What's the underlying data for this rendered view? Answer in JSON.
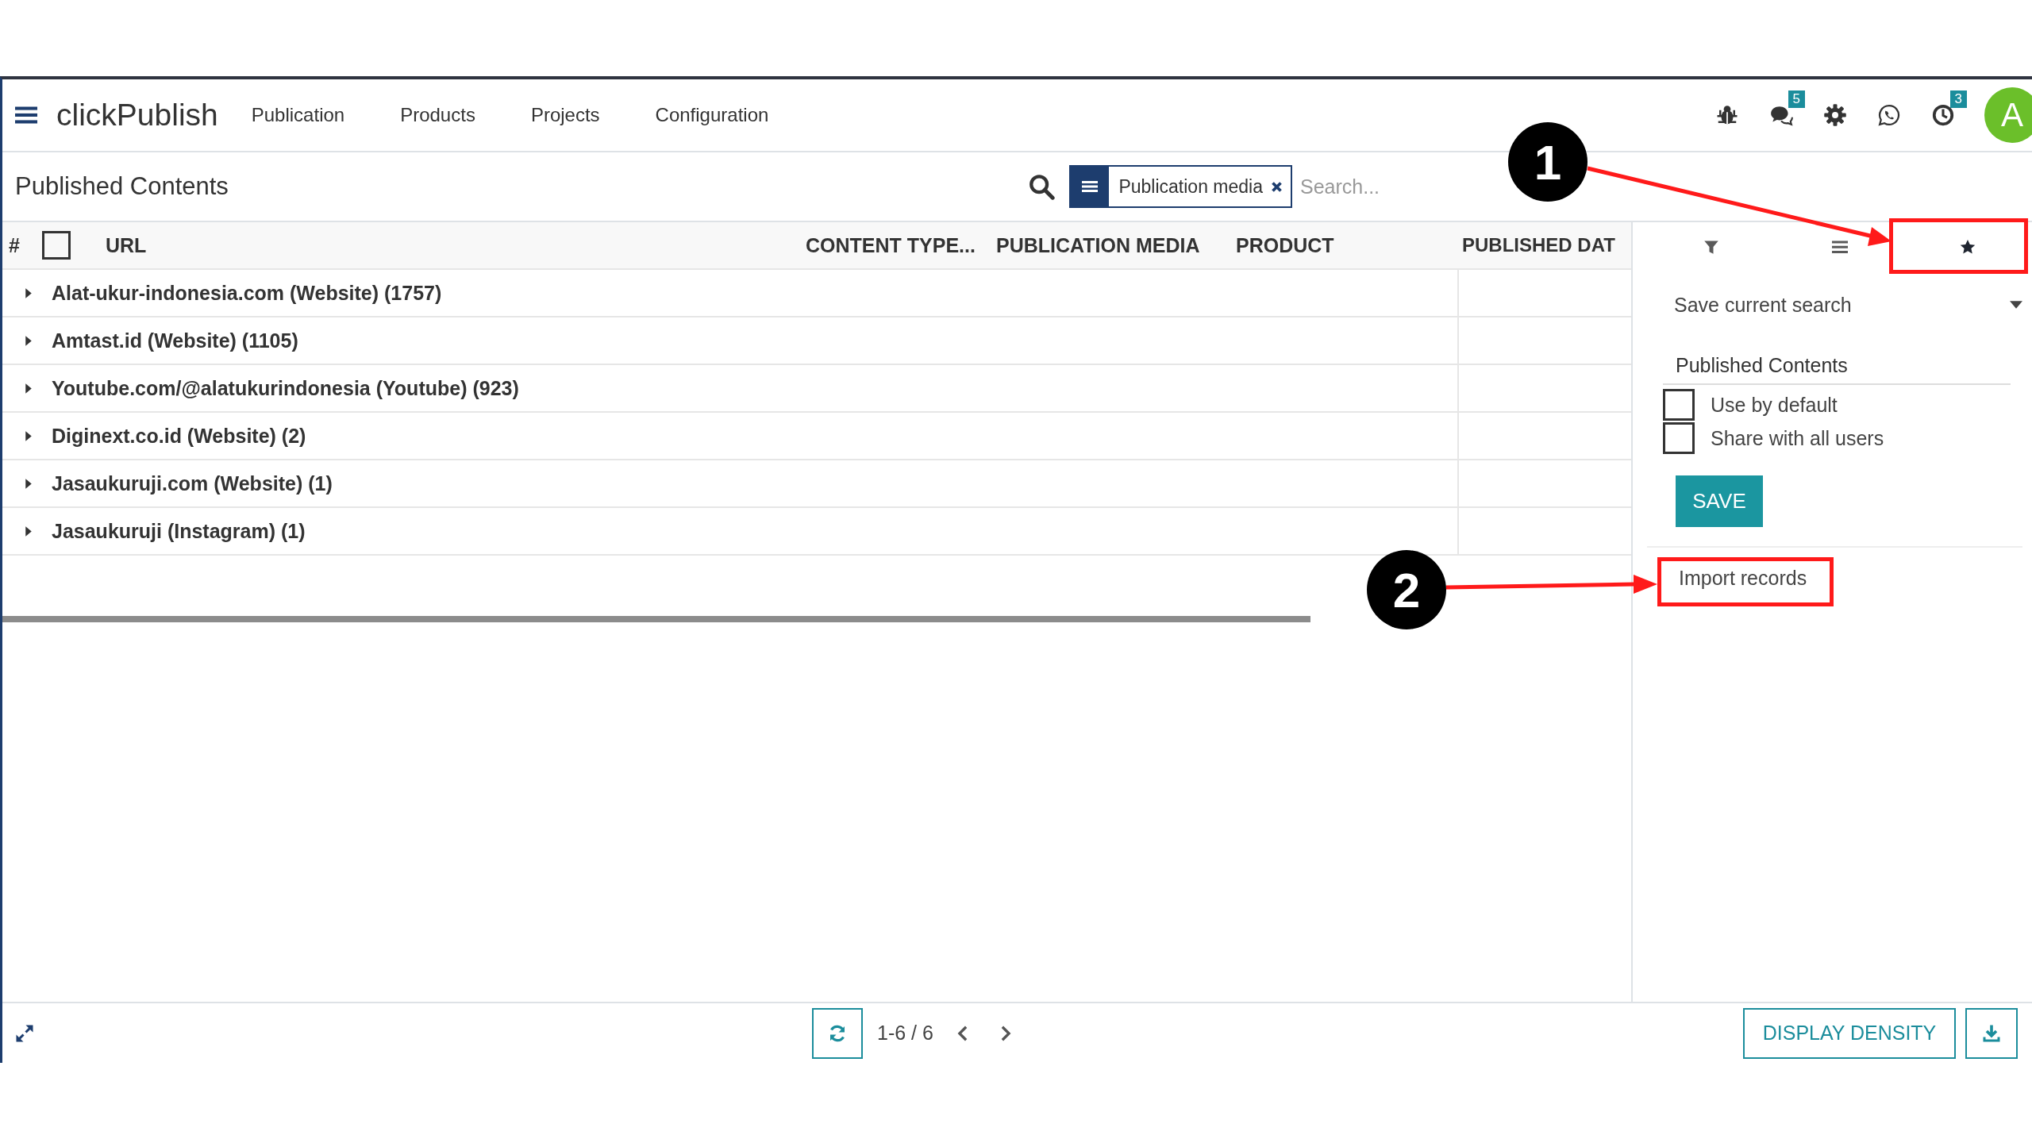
{
  "navbar": {
    "brand": "clickPublish",
    "menu": [
      "Publication",
      "Products",
      "Projects",
      "Configuration"
    ],
    "messages_badge": "5",
    "activities_badge": "3",
    "avatar": "A"
  },
  "control_panel": {
    "title": "Published Contents",
    "facet": "Publication media",
    "search_placeholder": "Search..."
  },
  "table": {
    "columns": [
      "#",
      "URL",
      "CONTENT TYPE...",
      "PUBLICATION MEDIA",
      "PRODUCT",
      "PUBLISHED DAT"
    ],
    "select_all_checked": false,
    "groups": [
      {
        "label": "Alat-ukur-indonesia.com (Website) (1757)",
        "expanded": false
      },
      {
        "label": "Amtast.id (Website) (1105)",
        "expanded": false
      },
      {
        "label": "Youtube.com/@alatukurindonesia (Youtube) (923)",
        "expanded": false
      },
      {
        "label": "Diginext.co.id (Website) (2)",
        "expanded": false
      },
      {
        "label": "Jasaukuruji.com (Website) (1)",
        "expanded": false
      },
      {
        "label": "Jasaukuruji (Instagram) (1)",
        "expanded": false
      }
    ]
  },
  "search_panel": {
    "tabs": [
      {
        "selected": false
      },
      {
        "selected": false
      },
      {
        "selected": true
      }
    ],
    "save_search": {
      "label": "Save current search",
      "expanded": true,
      "name": "Published Contents",
      "options": [
        {
          "label": "Use by default",
          "checked": false
        },
        {
          "label": "Share with all users",
          "checked": false
        }
      ],
      "save_button": "SAVE"
    },
    "import_link": "Import records"
  },
  "footer": {
    "pager": "1-6 / 6",
    "density_button": "DISPLAY DENSITY"
  },
  "annotations": [
    {
      "label": "1"
    },
    {
      "label": "2"
    }
  ]
}
